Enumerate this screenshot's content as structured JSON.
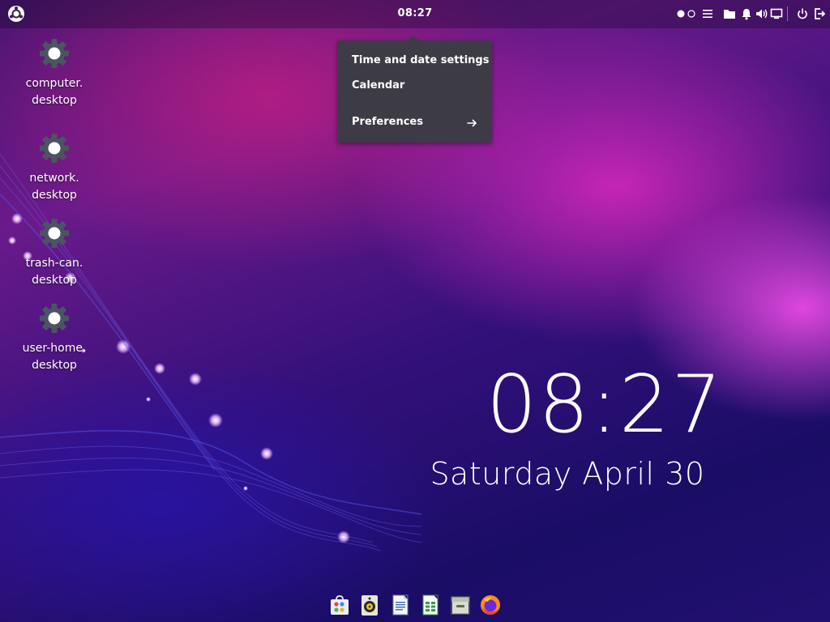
{
  "topbar": {
    "clock": "08:27",
    "icons": [
      "distro-logo-icon",
      "workspace-indicator-icon",
      "menu-icon",
      "folder-icon",
      "bell-icon",
      "volume-icon",
      "display-icon",
      "power-icon",
      "logout-icon"
    ]
  },
  "clock_menu": {
    "items": [
      {
        "label": "Time and date settings"
      },
      {
        "label": "Calendar"
      },
      {
        "label": "Preferences",
        "icon": "arrow-right-icon"
      }
    ]
  },
  "desktop_icons": [
    {
      "line1": "computer.",
      "line2": "desktop",
      "icon": "gear-icon"
    },
    {
      "line1": "network.",
      "line2": "desktop",
      "icon": "gear-icon"
    },
    {
      "line1": "trash-can.",
      "line2": "desktop",
      "icon": "gear-icon"
    },
    {
      "line1": "user-home.",
      "line2": "desktop",
      "icon": "gear-icon"
    }
  ],
  "big_clock": {
    "time": "08:27",
    "date": "Saturday April 30"
  },
  "dock": {
    "apps": [
      "software-store-icon",
      "music-player-icon",
      "text-editor-icon",
      "spreadsheet-icon",
      "archive-manager-icon",
      "firefox-icon"
    ]
  },
  "colors": {
    "menu_background": "#3d3b45",
    "text": "#ffffff",
    "accent_magenta": "#e040e0"
  }
}
